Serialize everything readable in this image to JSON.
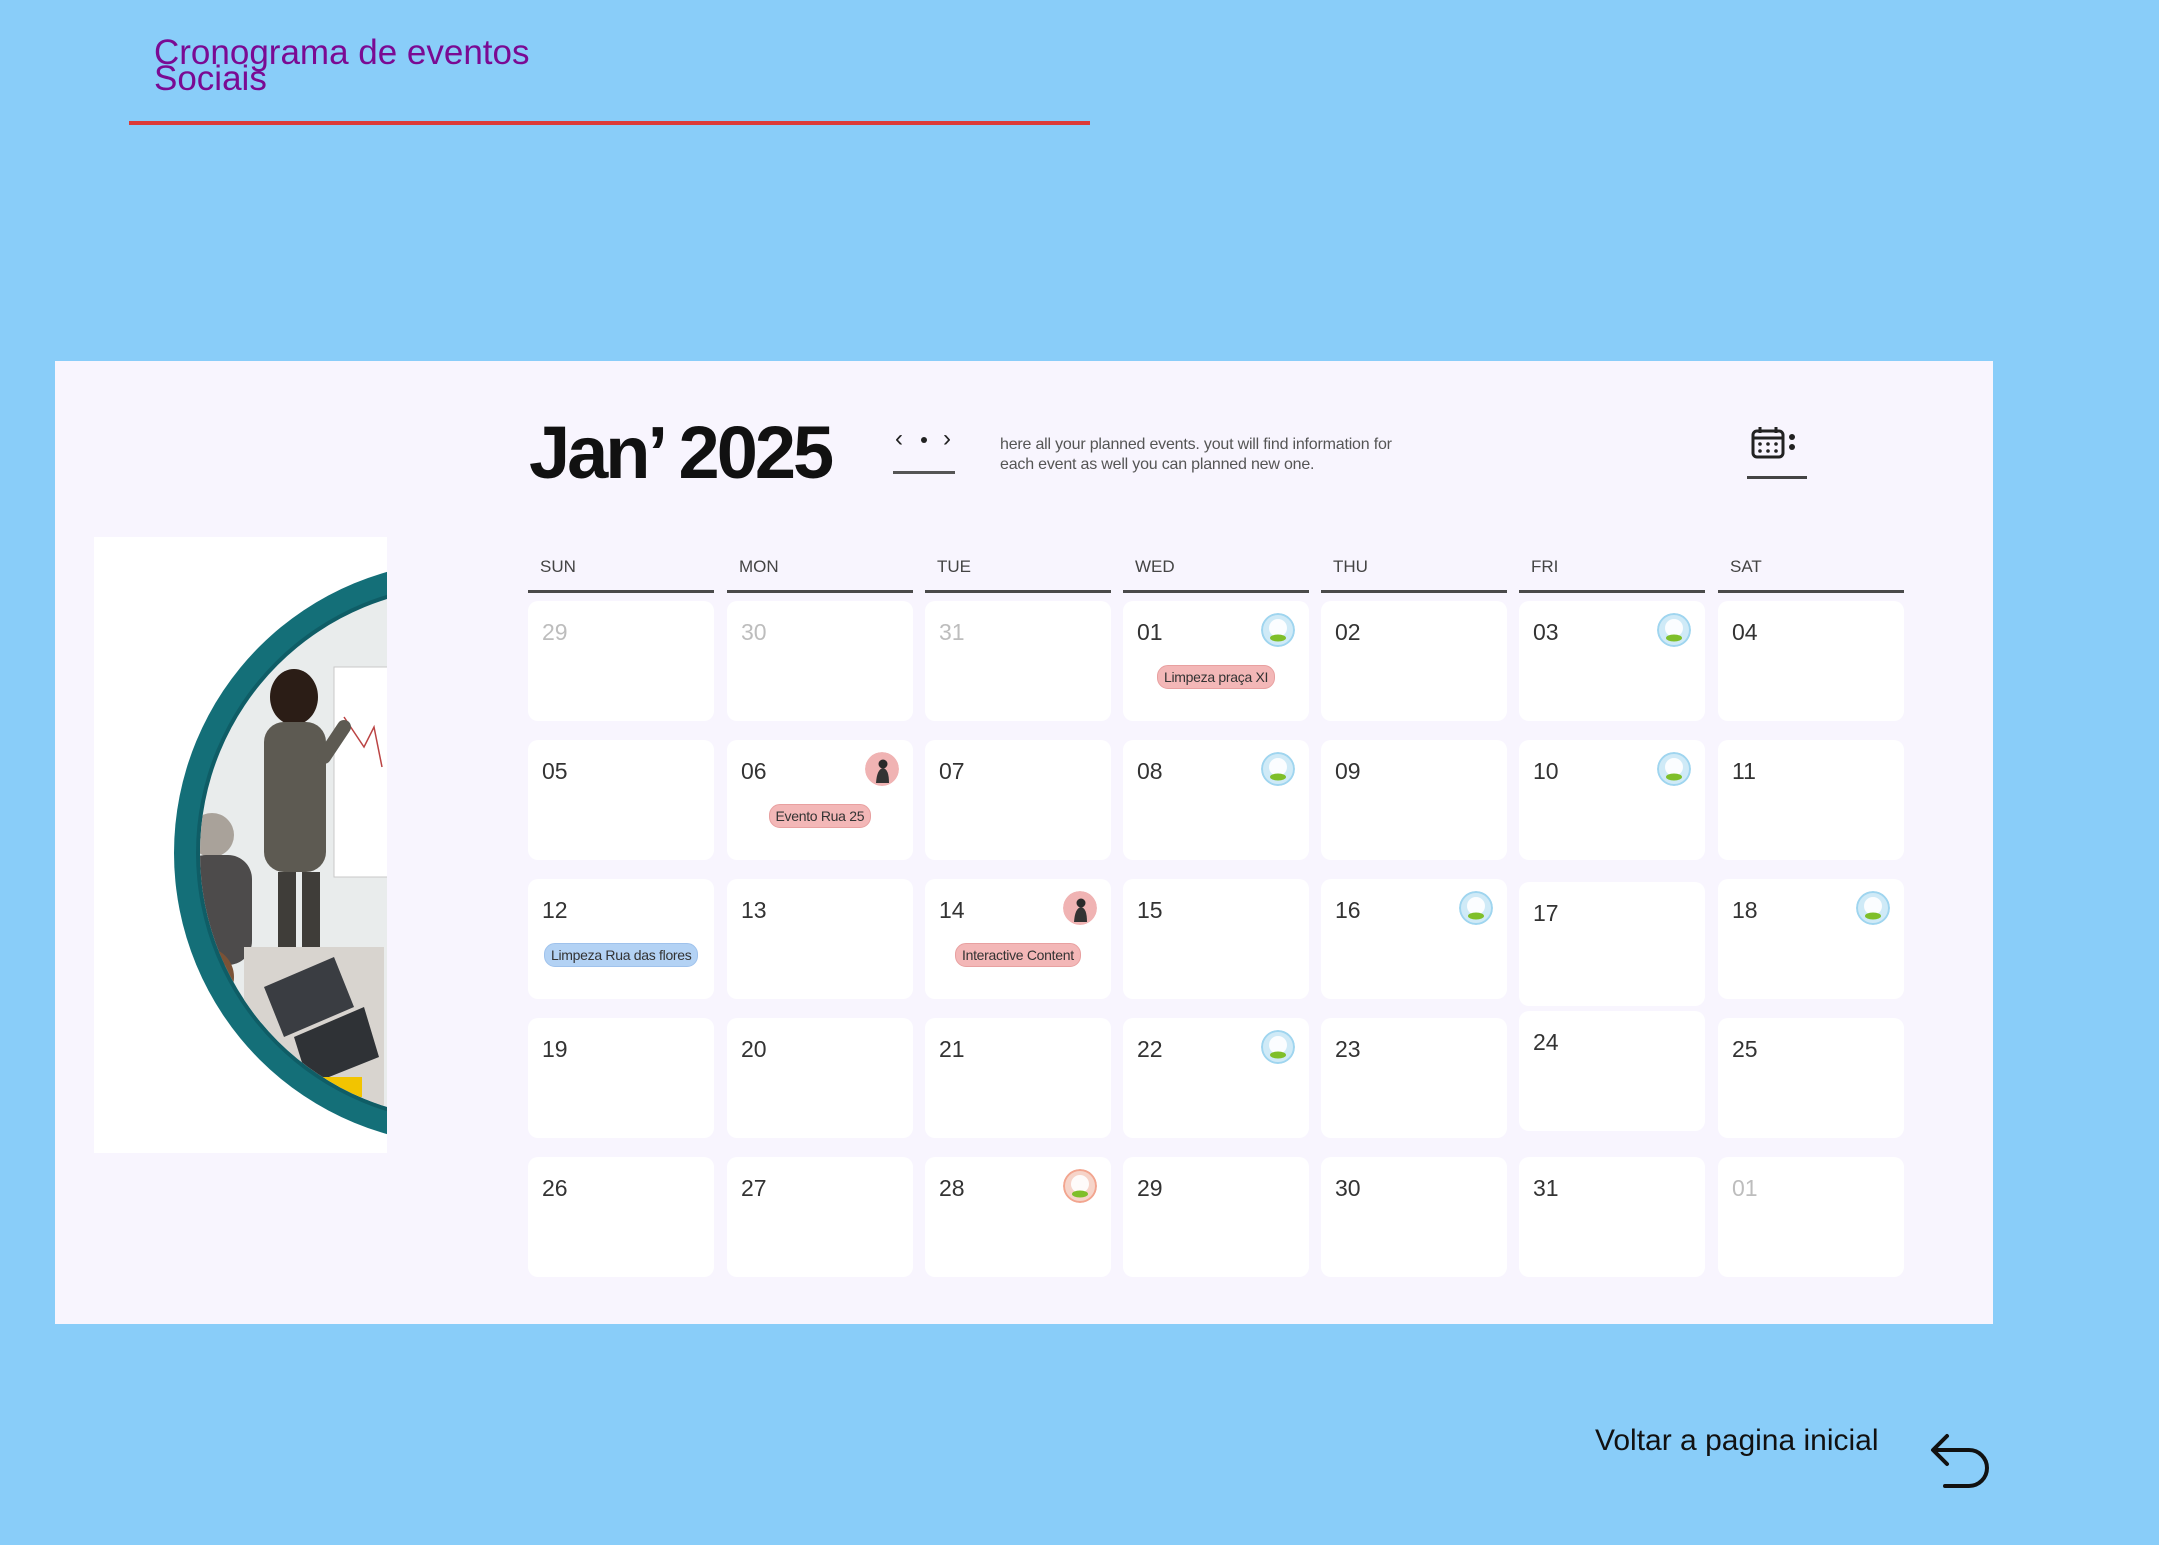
{
  "header": {
    "title_line1": "Cronograma de eventos",
    "title_line2": "Sociais"
  },
  "calendar": {
    "month_title": "Jan’ 2025",
    "prev_symbol": "‹",
    "next_symbol": "›",
    "intro_line1": "here all your planned events. yout will find information for",
    "intro_line2": "each event as well you can planned new one.",
    "menu_icon": "calendar-icon",
    "weekdays": [
      "SUN",
      "MON",
      "TUE",
      "WED",
      "THU",
      "FRI",
      "SAT"
    ],
    "weeks": [
      [
        {
          "day": "29",
          "muted": true
        },
        {
          "day": "30",
          "muted": true
        },
        {
          "day": "31",
          "muted": true
        },
        {
          "day": "01",
          "badge": "globe",
          "tag": "Limpeza praça XI",
          "tag_color": "pink"
        },
        {
          "day": "02"
        },
        {
          "day": "03",
          "badge": "globe"
        },
        {
          "day": "04"
        }
      ],
      [
        {
          "day": "05"
        },
        {
          "day": "06",
          "badge": "person",
          "tag": "Evento Rua 25",
          "tag_color": "pink"
        },
        {
          "day": "07"
        },
        {
          "day": "08",
          "badge": "globe"
        },
        {
          "day": "09"
        },
        {
          "day": "10",
          "badge": "globe"
        },
        {
          "day": "11"
        }
      ],
      [
        {
          "day": "12",
          "tag": "Limpeza Rua das flores",
          "tag_color": "blue"
        },
        {
          "day": "13"
        },
        {
          "day": "14",
          "badge": "person",
          "tag": "Interactive Content",
          "tag_color": "pink"
        },
        {
          "day": "15"
        },
        {
          "day": "16",
          "badge": "globe"
        },
        {
          "day": "17"
        },
        {
          "day": "18",
          "badge": "globe"
        }
      ],
      [
        {
          "day": "19"
        },
        {
          "day": "20"
        },
        {
          "day": "21"
        },
        {
          "day": "22",
          "badge": "globe"
        },
        {
          "day": "23"
        },
        {
          "day": "24"
        },
        {
          "day": "25"
        }
      ],
      [
        {
          "day": "26"
        },
        {
          "day": "27"
        },
        {
          "day": "28",
          "badge": "globe-warm"
        },
        {
          "day": "29"
        },
        {
          "day": "30"
        },
        {
          "day": "31"
        },
        {
          "day": "01",
          "muted": true
        }
      ]
    ]
  },
  "footer": {
    "back_label": "Voltar a  pagina inicial",
    "back_icon": "return-arrow-icon"
  },
  "colors": {
    "background": "#89cdf9",
    "title": "#7a0a93",
    "title_rule": "#dc3a38",
    "panel": "#f8f5fe",
    "tag_pink": "#f3b7b7",
    "tag_blue": "#b3d2f4",
    "frame_teal": "#146f78"
  }
}
